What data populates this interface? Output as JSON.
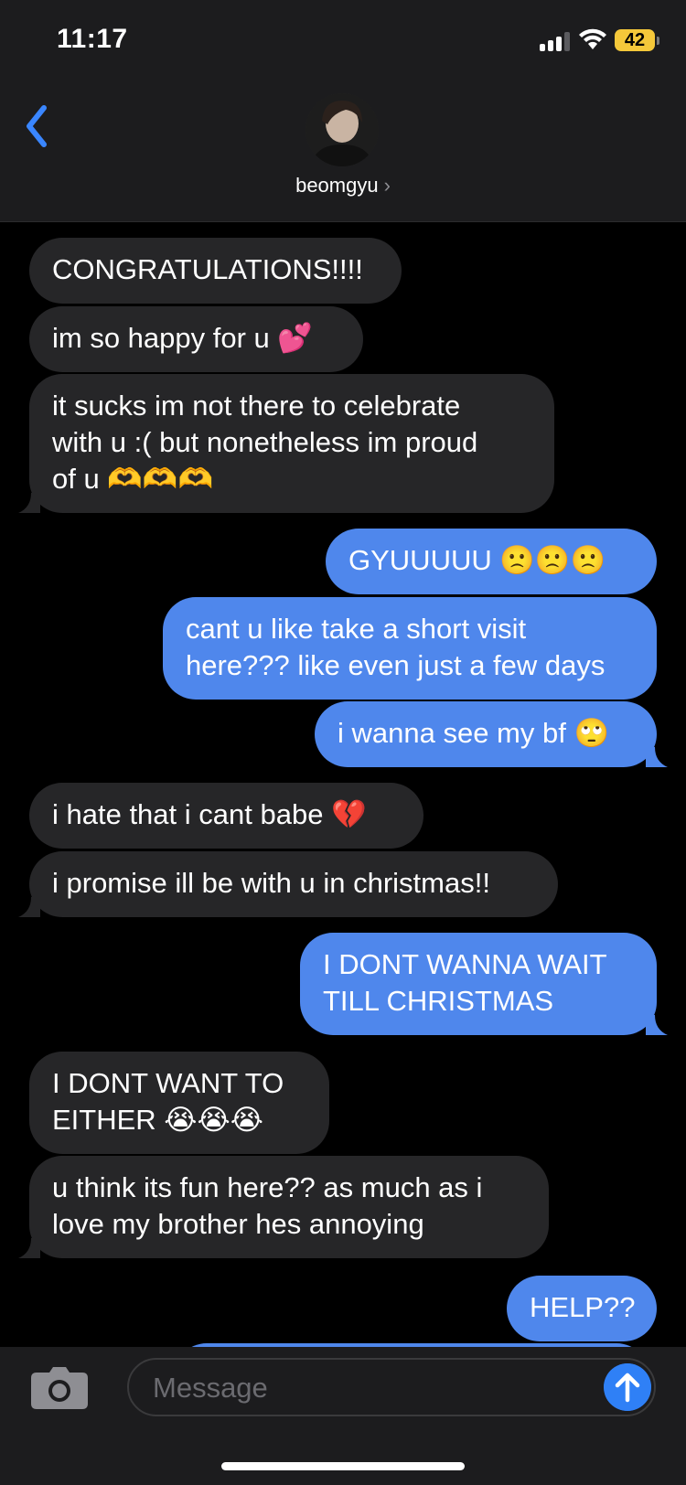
{
  "status_bar": {
    "time": "11:17",
    "battery": "42"
  },
  "header": {
    "contact_name": "beomgyu",
    "chevron": "›"
  },
  "messages": [
    {
      "from": "them",
      "text": "CONGRATULATIONS!!!!"
    },
    {
      "from": "them",
      "text": "im so happy for u 💕"
    },
    {
      "from": "them",
      "lines": [
        "it sucks im not there to celebrate",
        "with u :( but nonetheless im proud",
        "of u 🫶🫶🫶"
      ]
    },
    {
      "from": "me",
      "text": "GYUUUUU 🙁🙁🙁"
    },
    {
      "from": "me",
      "lines": [
        "cant u like take a short visit",
        "here??? like even just a few days"
      ]
    },
    {
      "from": "me",
      "text": "i wanna see my bf 🙄"
    },
    {
      "from": "them",
      "text": "i hate that i cant babe 💔"
    },
    {
      "from": "them",
      "text": "i promise ill be with u in christmas!!"
    },
    {
      "from": "me",
      "lines": [
        "I DONT WANNA WAIT",
        "TILL CHRISTMAS"
      ]
    },
    {
      "from": "them",
      "lines": [
        "I DONT WANT TO",
        "EITHER 😭😭😭"
      ]
    },
    {
      "from": "them",
      "lines": [
        "u think its fun here?? as much as i",
        "love my brother hes annoying"
      ]
    },
    {
      "from": "me",
      "text": "HELP??"
    }
  ],
  "composer": {
    "placeholder": "Message"
  },
  "colors": {
    "outgoing": "#4f87ec",
    "incoming": "#262628",
    "send": "#2f80f6"
  }
}
